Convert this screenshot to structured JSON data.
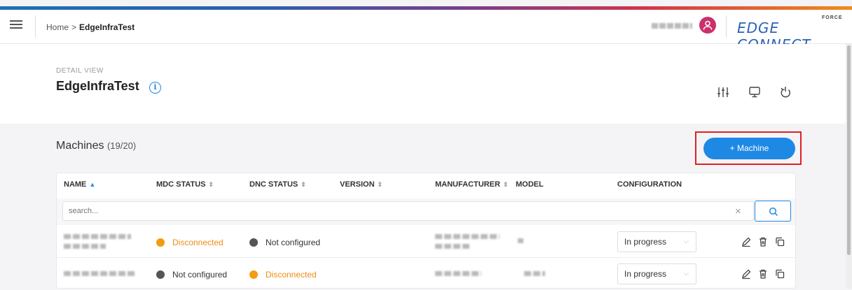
{
  "header": {
    "breadcrumb": {
      "home": "Home",
      "separator": ">",
      "current": "EdgeInfraTest"
    },
    "brand": "EDGE CONNECT",
    "brand_sup": "FORCE",
    "user_icon": "user-icon"
  },
  "detail": {
    "kicker": "DETAIL VIEW",
    "title": "EdgeInfraTest",
    "info_icon": "i"
  },
  "machines": {
    "title": "Machines",
    "count": "(19/20)",
    "add_button": "+ Machine",
    "columns": [
      "NAME",
      "MDC STATUS",
      "DNC STATUS",
      "VERSION",
      "MANUFACTURER",
      "MODEL",
      "CONFIGURATION"
    ],
    "search_placeholder": "search...",
    "rows": [
      {
        "mdc_status": "Disconnected",
        "dnc_status": "Not configured",
        "configuration": "In progress"
      },
      {
        "mdc_status": "Not configured",
        "dnc_status": "Disconnected",
        "configuration": "In progress"
      }
    ]
  },
  "colors": {
    "accent": "#1e88e5",
    "orange": "#f08c10",
    "grey_dot": "#555555",
    "highlight": "#e02020",
    "avatar": "#cc2f6c"
  }
}
